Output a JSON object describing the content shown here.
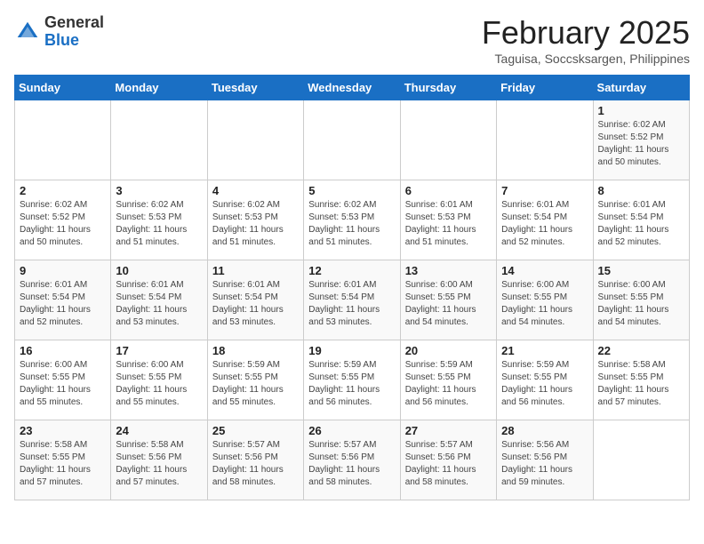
{
  "header": {
    "logo_general": "General",
    "logo_blue": "Blue",
    "month_title": "February 2025",
    "location": "Taguisa, Soccsksargen, Philippines"
  },
  "weekdays": [
    "Sunday",
    "Monday",
    "Tuesday",
    "Wednesday",
    "Thursday",
    "Friday",
    "Saturday"
  ],
  "weeks": [
    [
      {
        "day": "",
        "info": ""
      },
      {
        "day": "",
        "info": ""
      },
      {
        "day": "",
        "info": ""
      },
      {
        "day": "",
        "info": ""
      },
      {
        "day": "",
        "info": ""
      },
      {
        "day": "",
        "info": ""
      },
      {
        "day": "1",
        "info": "Sunrise: 6:02 AM\nSunset: 5:52 PM\nDaylight: 11 hours and 50 minutes."
      }
    ],
    [
      {
        "day": "2",
        "info": "Sunrise: 6:02 AM\nSunset: 5:52 PM\nDaylight: 11 hours and 50 minutes."
      },
      {
        "day": "3",
        "info": "Sunrise: 6:02 AM\nSunset: 5:53 PM\nDaylight: 11 hours and 51 minutes."
      },
      {
        "day": "4",
        "info": "Sunrise: 6:02 AM\nSunset: 5:53 PM\nDaylight: 11 hours and 51 minutes."
      },
      {
        "day": "5",
        "info": "Sunrise: 6:02 AM\nSunset: 5:53 PM\nDaylight: 11 hours and 51 minutes."
      },
      {
        "day": "6",
        "info": "Sunrise: 6:01 AM\nSunset: 5:53 PM\nDaylight: 11 hours and 51 minutes."
      },
      {
        "day": "7",
        "info": "Sunrise: 6:01 AM\nSunset: 5:54 PM\nDaylight: 11 hours and 52 minutes."
      },
      {
        "day": "8",
        "info": "Sunrise: 6:01 AM\nSunset: 5:54 PM\nDaylight: 11 hours and 52 minutes."
      }
    ],
    [
      {
        "day": "9",
        "info": "Sunrise: 6:01 AM\nSunset: 5:54 PM\nDaylight: 11 hours and 52 minutes."
      },
      {
        "day": "10",
        "info": "Sunrise: 6:01 AM\nSunset: 5:54 PM\nDaylight: 11 hours and 53 minutes."
      },
      {
        "day": "11",
        "info": "Sunrise: 6:01 AM\nSunset: 5:54 PM\nDaylight: 11 hours and 53 minutes."
      },
      {
        "day": "12",
        "info": "Sunrise: 6:01 AM\nSunset: 5:54 PM\nDaylight: 11 hours and 53 minutes."
      },
      {
        "day": "13",
        "info": "Sunrise: 6:00 AM\nSunset: 5:55 PM\nDaylight: 11 hours and 54 minutes."
      },
      {
        "day": "14",
        "info": "Sunrise: 6:00 AM\nSunset: 5:55 PM\nDaylight: 11 hours and 54 minutes."
      },
      {
        "day": "15",
        "info": "Sunrise: 6:00 AM\nSunset: 5:55 PM\nDaylight: 11 hours and 54 minutes."
      }
    ],
    [
      {
        "day": "16",
        "info": "Sunrise: 6:00 AM\nSunset: 5:55 PM\nDaylight: 11 hours and 55 minutes."
      },
      {
        "day": "17",
        "info": "Sunrise: 6:00 AM\nSunset: 5:55 PM\nDaylight: 11 hours and 55 minutes."
      },
      {
        "day": "18",
        "info": "Sunrise: 5:59 AM\nSunset: 5:55 PM\nDaylight: 11 hours and 55 minutes."
      },
      {
        "day": "19",
        "info": "Sunrise: 5:59 AM\nSunset: 5:55 PM\nDaylight: 11 hours and 56 minutes."
      },
      {
        "day": "20",
        "info": "Sunrise: 5:59 AM\nSunset: 5:55 PM\nDaylight: 11 hours and 56 minutes."
      },
      {
        "day": "21",
        "info": "Sunrise: 5:59 AM\nSunset: 5:55 PM\nDaylight: 11 hours and 56 minutes."
      },
      {
        "day": "22",
        "info": "Sunrise: 5:58 AM\nSunset: 5:55 PM\nDaylight: 11 hours and 57 minutes."
      }
    ],
    [
      {
        "day": "23",
        "info": "Sunrise: 5:58 AM\nSunset: 5:55 PM\nDaylight: 11 hours and 57 minutes."
      },
      {
        "day": "24",
        "info": "Sunrise: 5:58 AM\nSunset: 5:56 PM\nDaylight: 11 hours and 57 minutes."
      },
      {
        "day": "25",
        "info": "Sunrise: 5:57 AM\nSunset: 5:56 PM\nDaylight: 11 hours and 58 minutes."
      },
      {
        "day": "26",
        "info": "Sunrise: 5:57 AM\nSunset: 5:56 PM\nDaylight: 11 hours and 58 minutes."
      },
      {
        "day": "27",
        "info": "Sunrise: 5:57 AM\nSunset: 5:56 PM\nDaylight: 11 hours and 58 minutes."
      },
      {
        "day": "28",
        "info": "Sunrise: 5:56 AM\nSunset: 5:56 PM\nDaylight: 11 hours and 59 minutes."
      },
      {
        "day": "",
        "info": ""
      }
    ]
  ]
}
